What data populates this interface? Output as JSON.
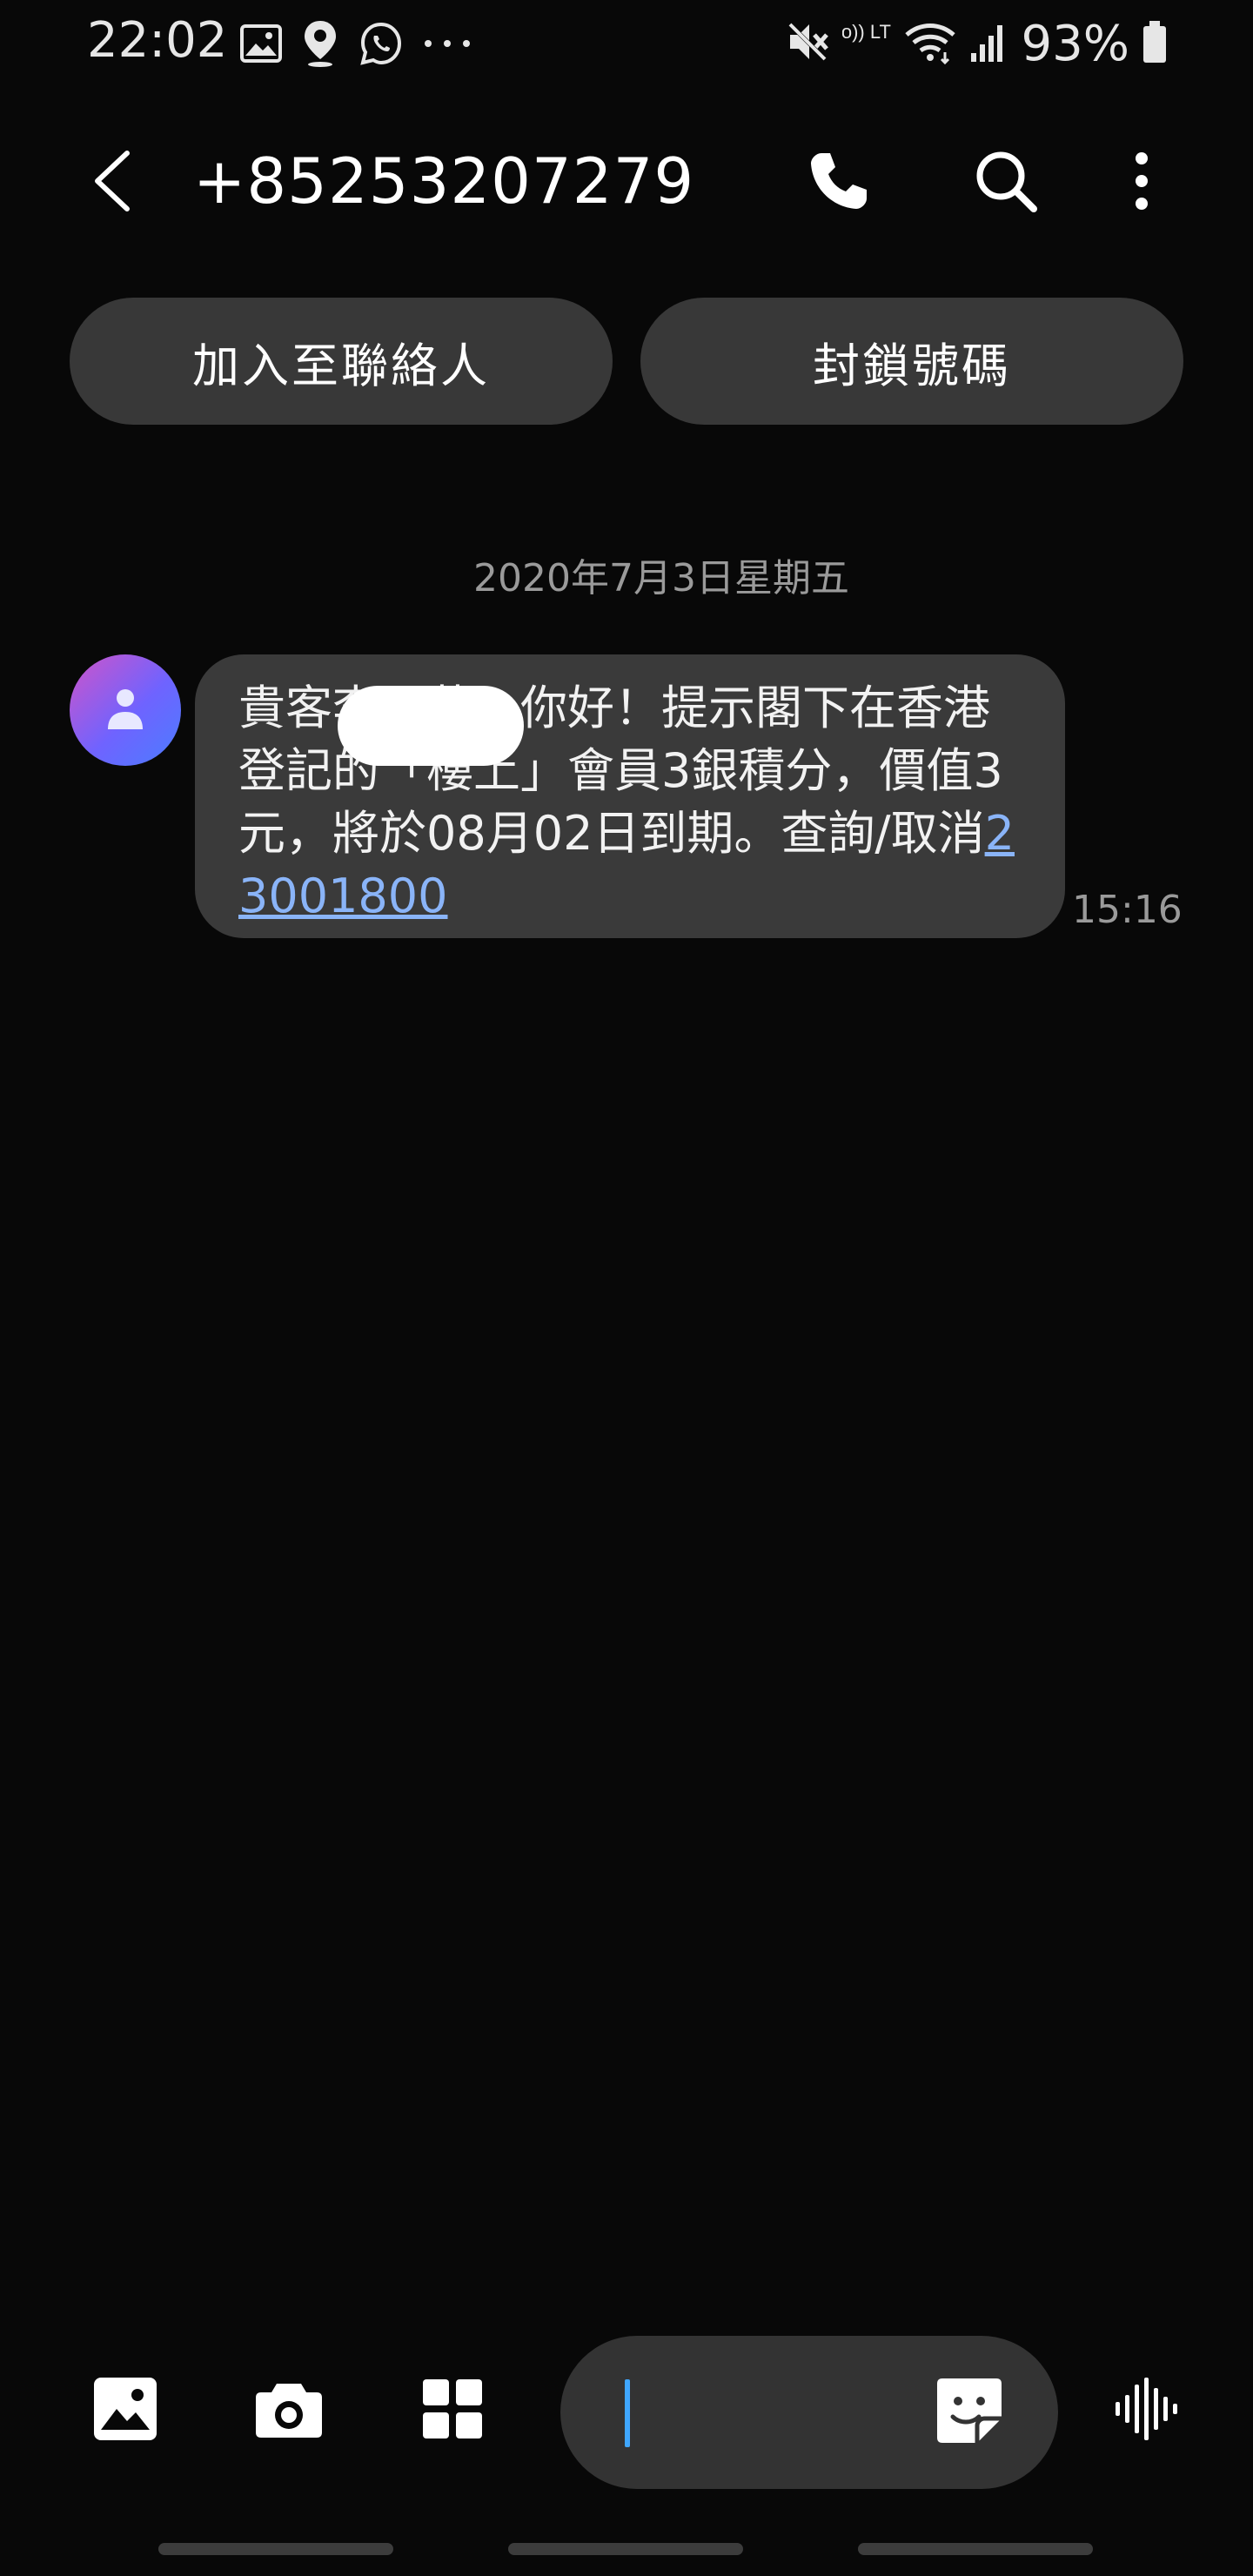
{
  "status_bar": {
    "time": "22:02",
    "battery": "93%",
    "volte_label": "Vo)) LTE",
    "icons_left": [
      "image-notification-icon",
      "location-notification-icon",
      "whatsapp-notification-icon",
      "more-notifications-icon"
    ],
    "icons_right": [
      "mute-icon",
      "volte-icon",
      "wifi-icon",
      "signal-icon",
      "battery-icon"
    ]
  },
  "app_bar": {
    "title": "+85253207279",
    "actions": [
      "back-arrow-icon",
      "phone-icon",
      "search-icon",
      "more-vertical-icon"
    ]
  },
  "chips": {
    "add_contact": "加入至聯絡人",
    "block_number": "封鎖號碼"
  },
  "conversation": {
    "date": "2020年7月3日星期五",
    "messages": [
      {
        "text": "貴客李君藝，你好！提示閣下在香港登記的「樓上」會員3銀積分，價值3元，將於08月02日到期。查詢/取消",
        "link": "23001800",
        "time": "15:16"
      }
    ]
  },
  "composer": {
    "value": "",
    "icons": [
      "gallery-icon",
      "camera-icon",
      "apps-grid-icon",
      "sticker-icon",
      "voice-waveform-icon"
    ]
  },
  "colors": {
    "background": "#080808",
    "bubble": "#3a3a3a",
    "chip": "#383838",
    "link": "#8ab4f8",
    "cursor": "#3fa7ff",
    "avatar_gradient": [
      "#d054c8",
      "#6f63ff",
      "#4b7dff"
    ]
  }
}
